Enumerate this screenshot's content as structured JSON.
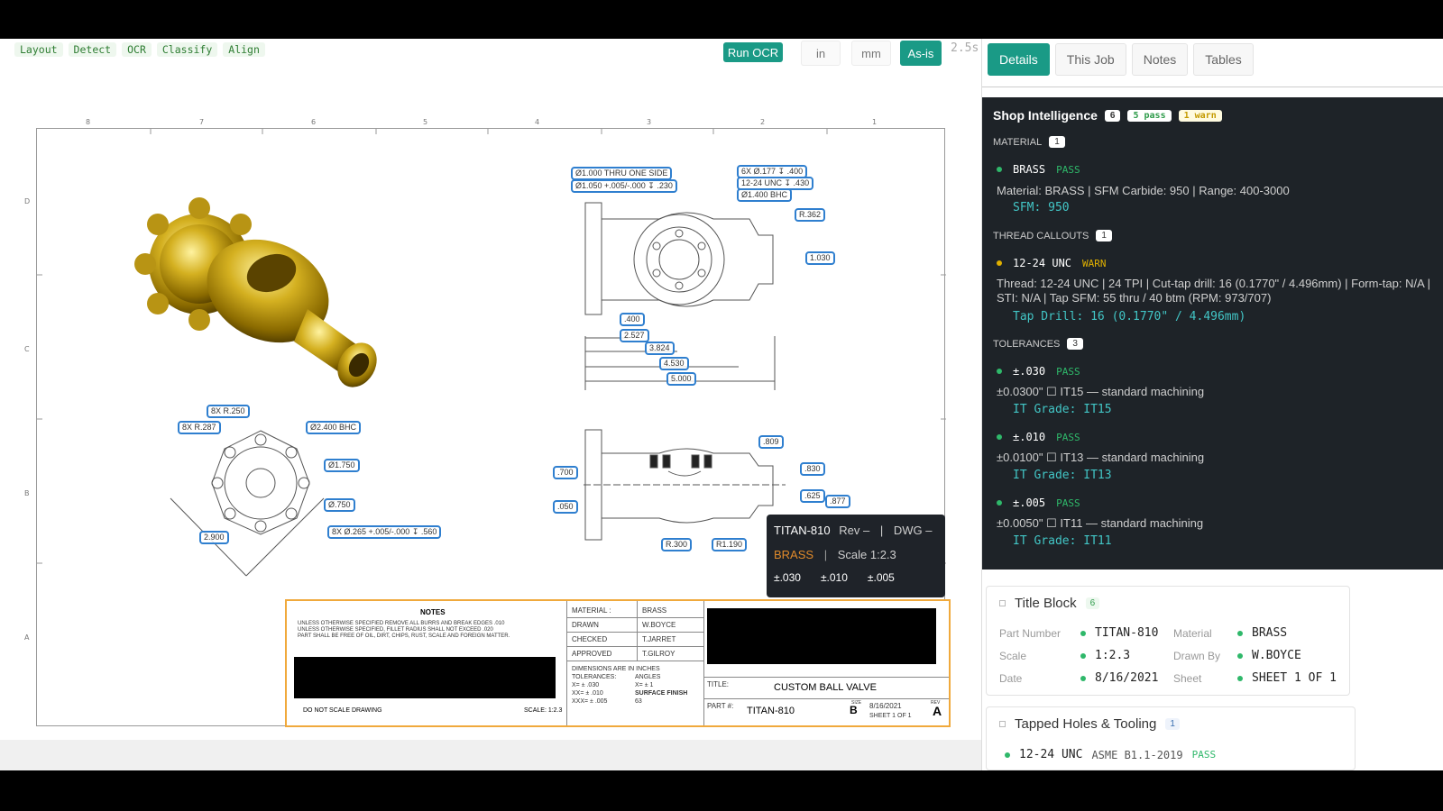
{
  "toolbar": {
    "modes": [
      "Layout",
      "Detect",
      "OCR",
      "Classify",
      "Align"
    ],
    "run_label": "Run OCR",
    "units": [
      "in",
      "mm",
      "As-is"
    ],
    "timer": "2.5s"
  },
  "drawing": {
    "zones_top": [
      "8",
      "7",
      "6",
      "5",
      "4",
      "3",
      "2",
      "1"
    ],
    "zones_side": [
      "D",
      "C",
      "B",
      "A"
    ],
    "callouts": {
      "thru": "Ø1.000 THRU ONE SIDE",
      "cbore": "Ø1.050 +.005/-.000 ↧ .230",
      "holes6x": "6X Ø.177 ↧ .400",
      "thread": "12-24 UNC ↧ .430",
      "bhc": "Ø1.400 BHC",
      "r362": "R.362",
      "d1030": "1.030",
      "d400": ".400",
      "d2527": "2.527",
      "d3824": "3.824",
      "d4530": "4.530",
      "d5000": "5.000",
      "r250": "8X R.250",
      "r287": "8X R.287",
      "bhc2": "Ø2.400 BHC",
      "d1750": "Ø1.750",
      "d750": "Ø.750",
      "d2900": "2.900",
      "holes8x": "8X Ø.265 +.005/-.000 ↧ .560",
      "d809": ".809",
      "d700": ".700",
      "d050": ".050",
      "d830": ".830",
      "d625": ".625",
      "d877": ".877",
      "r300": "R.300",
      "r1190": "R1.190"
    }
  },
  "tooltip": {
    "part": "TITAN-810",
    "rev": "Rev –",
    "sep": "|",
    "dwg": "DWG –",
    "material": "BRASS",
    "scale": "Scale 1:2.3",
    "tolerances": [
      "±.030",
      "±.010",
      "±.005"
    ]
  },
  "titleblock": {
    "notes_heading": "NOTES",
    "notes": "UNLESS OTHERWISE SPECIFIED REMOVE ALL BURRS AND BREAK EDGES .010\nUNLESS OTHERWISE SPECIFIED, FILLET RADIUS SHALL NOT EXCEED .020\nPART SHALL BE FREE OF OIL, DIRT, CHIPS, RUST, SCALE AND FOREIGN MATTER.",
    "do_not_scale": "DO NOT SCALE DRAWING",
    "scale": "SCALE: 1:2.3",
    "material_label": "MATERIAL :",
    "material": "BRASS",
    "drawn_label": "DRAWN",
    "drawn": "W.BOYCE",
    "checked_label": "CHECKED",
    "checked": "T.JARRET",
    "approved_label": "APPROVED",
    "approved": "T.GILROY",
    "dims_note": "DIMENSIONS ARE IN INCHES",
    "tol_label": "TOLERANCES:",
    "tol_x": "X= ± .030",
    "tol_xx": "XX= ± .010",
    "tol_xxx": "XXX= ± .005",
    "angles_label": "ANGLES",
    "angles": "X= ± 1",
    "surface_finish": "SURFACE FINISH",
    "finish_val": "63",
    "title_label": "TITLE:",
    "title": "CUSTOM BALL VALVE",
    "part_label": "PART #:",
    "part": "TITAN-810",
    "size_label": "SIZE",
    "size": "B",
    "date": "8/16/2021",
    "sheet": "SHEET 1 OF 1",
    "rev_label": "REV",
    "rev": "A"
  },
  "right": {
    "tabs": [
      "Details",
      "This Job",
      "Notes",
      "Tables"
    ],
    "intel": {
      "title": "Shop Intelligence",
      "count": "6",
      "pass": "5 pass",
      "warn": "1 warn",
      "material_section": "MATERIAL",
      "material_count": "1",
      "material_name": "BRASS",
      "material_status": "PASS",
      "material_desc": "Material: BRASS | SFM Carbide: 950 | Range: 400-3000",
      "material_code": "SFM: 950",
      "thread_section": "THREAD CALLOUTS",
      "thread_count": "1",
      "thread_name": "12-24 UNC",
      "thread_status": "WARN",
      "thread_desc": "Thread: 12-24 UNC | 24 TPI | Cut-tap drill: 16 (0.1770\" / 4.496mm) | Form-tap: N/A | STI: N/A | Tap SFM: 55 thru / 40 btm (RPM: 973/707)",
      "thread_code": "Tap Drill: 16 (0.1770\" / 4.496mm)",
      "tol_section": "TOLERANCES",
      "tol_count": "3",
      "tols": [
        {
          "name": "±.030",
          "status": "PASS",
          "desc": "±0.0300\" ☐ IT15 — standard machining",
          "code": "IT Grade: IT15"
        },
        {
          "name": "±.010",
          "status": "PASS",
          "desc": "±0.0100\" ☐ IT13 — standard machining",
          "code": "IT Grade: IT13"
        },
        {
          "name": "±.005",
          "status": "PASS",
          "desc": "±0.0050\" ☐ IT11 — standard machining",
          "code": "IT Grade: IT11"
        }
      ]
    },
    "titleblock_card": {
      "title": "Title Block",
      "count": "6",
      "part_label": "Part Number",
      "part": "TITAN-810",
      "material_label": "Material",
      "material": "BRASS",
      "scale_label": "Scale",
      "scale": "1:2.3",
      "drawn_label": "Drawn By",
      "drawn": "W.BOYCE",
      "date_label": "Date",
      "date": "8/16/2021",
      "sheet_label": "Sheet",
      "sheet": "SHEET 1 OF 1"
    },
    "tapped_card": {
      "title": "Tapped Holes & Tooling",
      "count": "1",
      "item": "12-24 UNC",
      "standard": "ASME B1.1-2019",
      "status": "PASS"
    }
  }
}
